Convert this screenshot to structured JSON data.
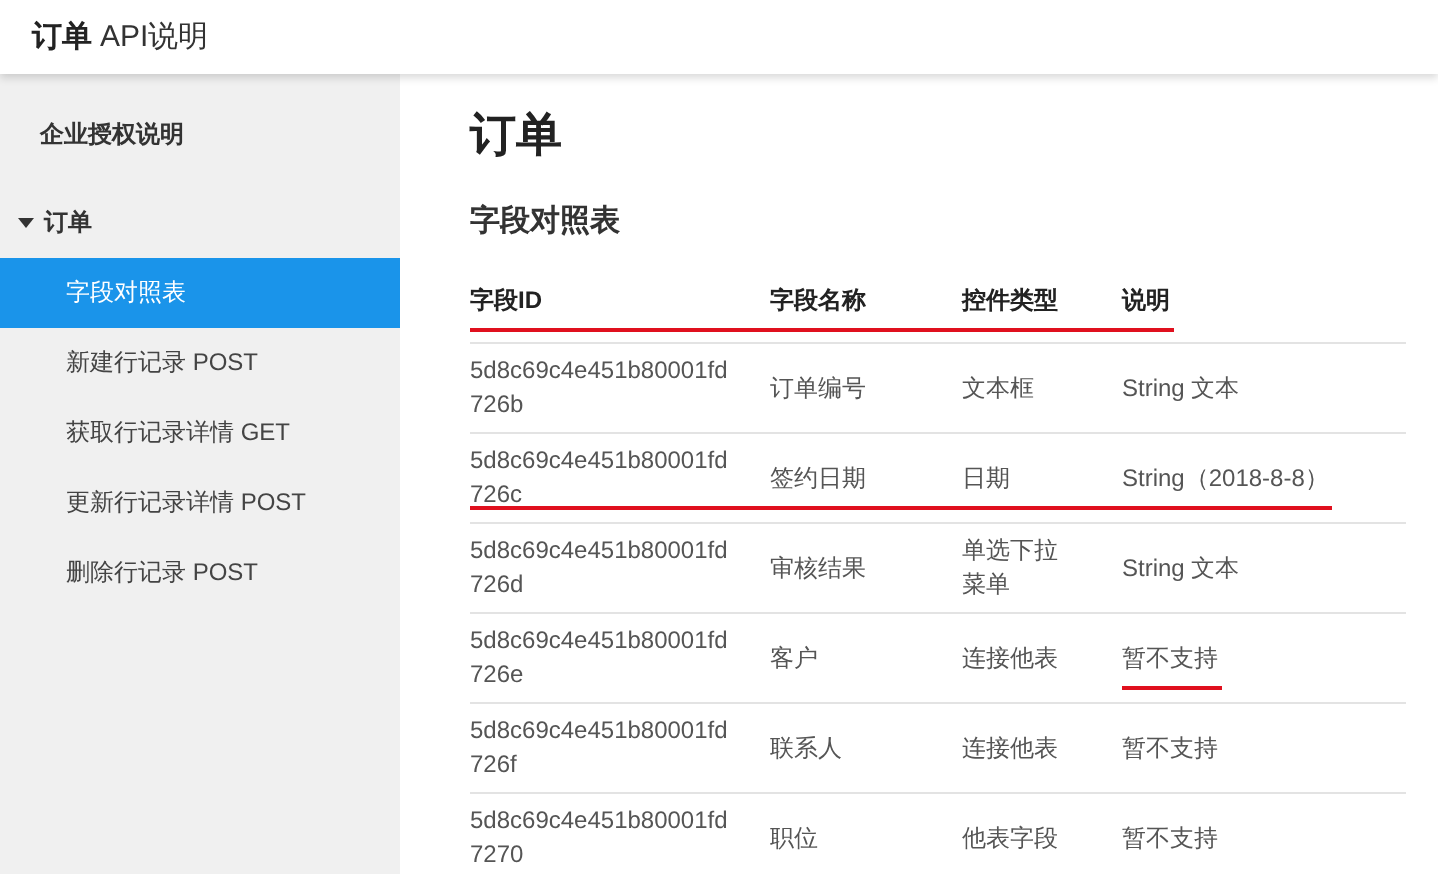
{
  "header": {
    "title_bold": "订单",
    "title_rest": "API说明"
  },
  "sidebar": {
    "items": [
      {
        "label": "企业授权说明",
        "kind": "section",
        "selected": false
      },
      {
        "label": "订单",
        "kind": "group",
        "expanded": true,
        "selected": false,
        "children": [
          {
            "label": "字段对照表",
            "selected": true
          },
          {
            "label": "新建行记录 POST",
            "selected": false
          },
          {
            "label": "获取行记录详情 GET",
            "selected": false
          },
          {
            "label": "更新行记录详情 POST",
            "selected": false
          },
          {
            "label": "删除行记录 POST",
            "selected": false
          }
        ]
      }
    ]
  },
  "main": {
    "title": "订单",
    "subtitle": "字段对照表",
    "table": {
      "columns": [
        "字段ID",
        "字段名称",
        "控件类型",
        "说明"
      ],
      "header_underlined": true,
      "rows": [
        {
          "cells": [
            "5d8c69c4e451b80001fd726b",
            "订单编号",
            "文本框",
            "String 文本"
          ],
          "row_underlined": false,
          "description_underlined": false
        },
        {
          "cells": [
            "5d8c69c4e451b80001fd726c",
            "签约日期",
            "日期",
            "String（2018-8-8）"
          ],
          "row_underlined": true,
          "description_underlined": false
        },
        {
          "cells": [
            "5d8c69c4e451b80001fd726d",
            "审核结果",
            "单选下拉菜单",
            "String 文本"
          ],
          "row_underlined": false,
          "description_underlined": false
        },
        {
          "cells": [
            "5d8c69c4e451b80001fd726e",
            "客户",
            "连接他表",
            "暂不支持"
          ],
          "row_underlined": false,
          "description_underlined": true
        },
        {
          "cells": [
            "5d8c69c4e451b80001fd726f",
            "联系人",
            "连接他表",
            "暂不支持"
          ],
          "row_underlined": false,
          "description_underlined": false
        },
        {
          "cells": [
            "5d8c69c4e451b80001fd7270",
            "职位",
            "他表字段",
            "暂不支持"
          ],
          "row_underlined": false,
          "description_underlined": false
        }
      ]
    }
  }
}
